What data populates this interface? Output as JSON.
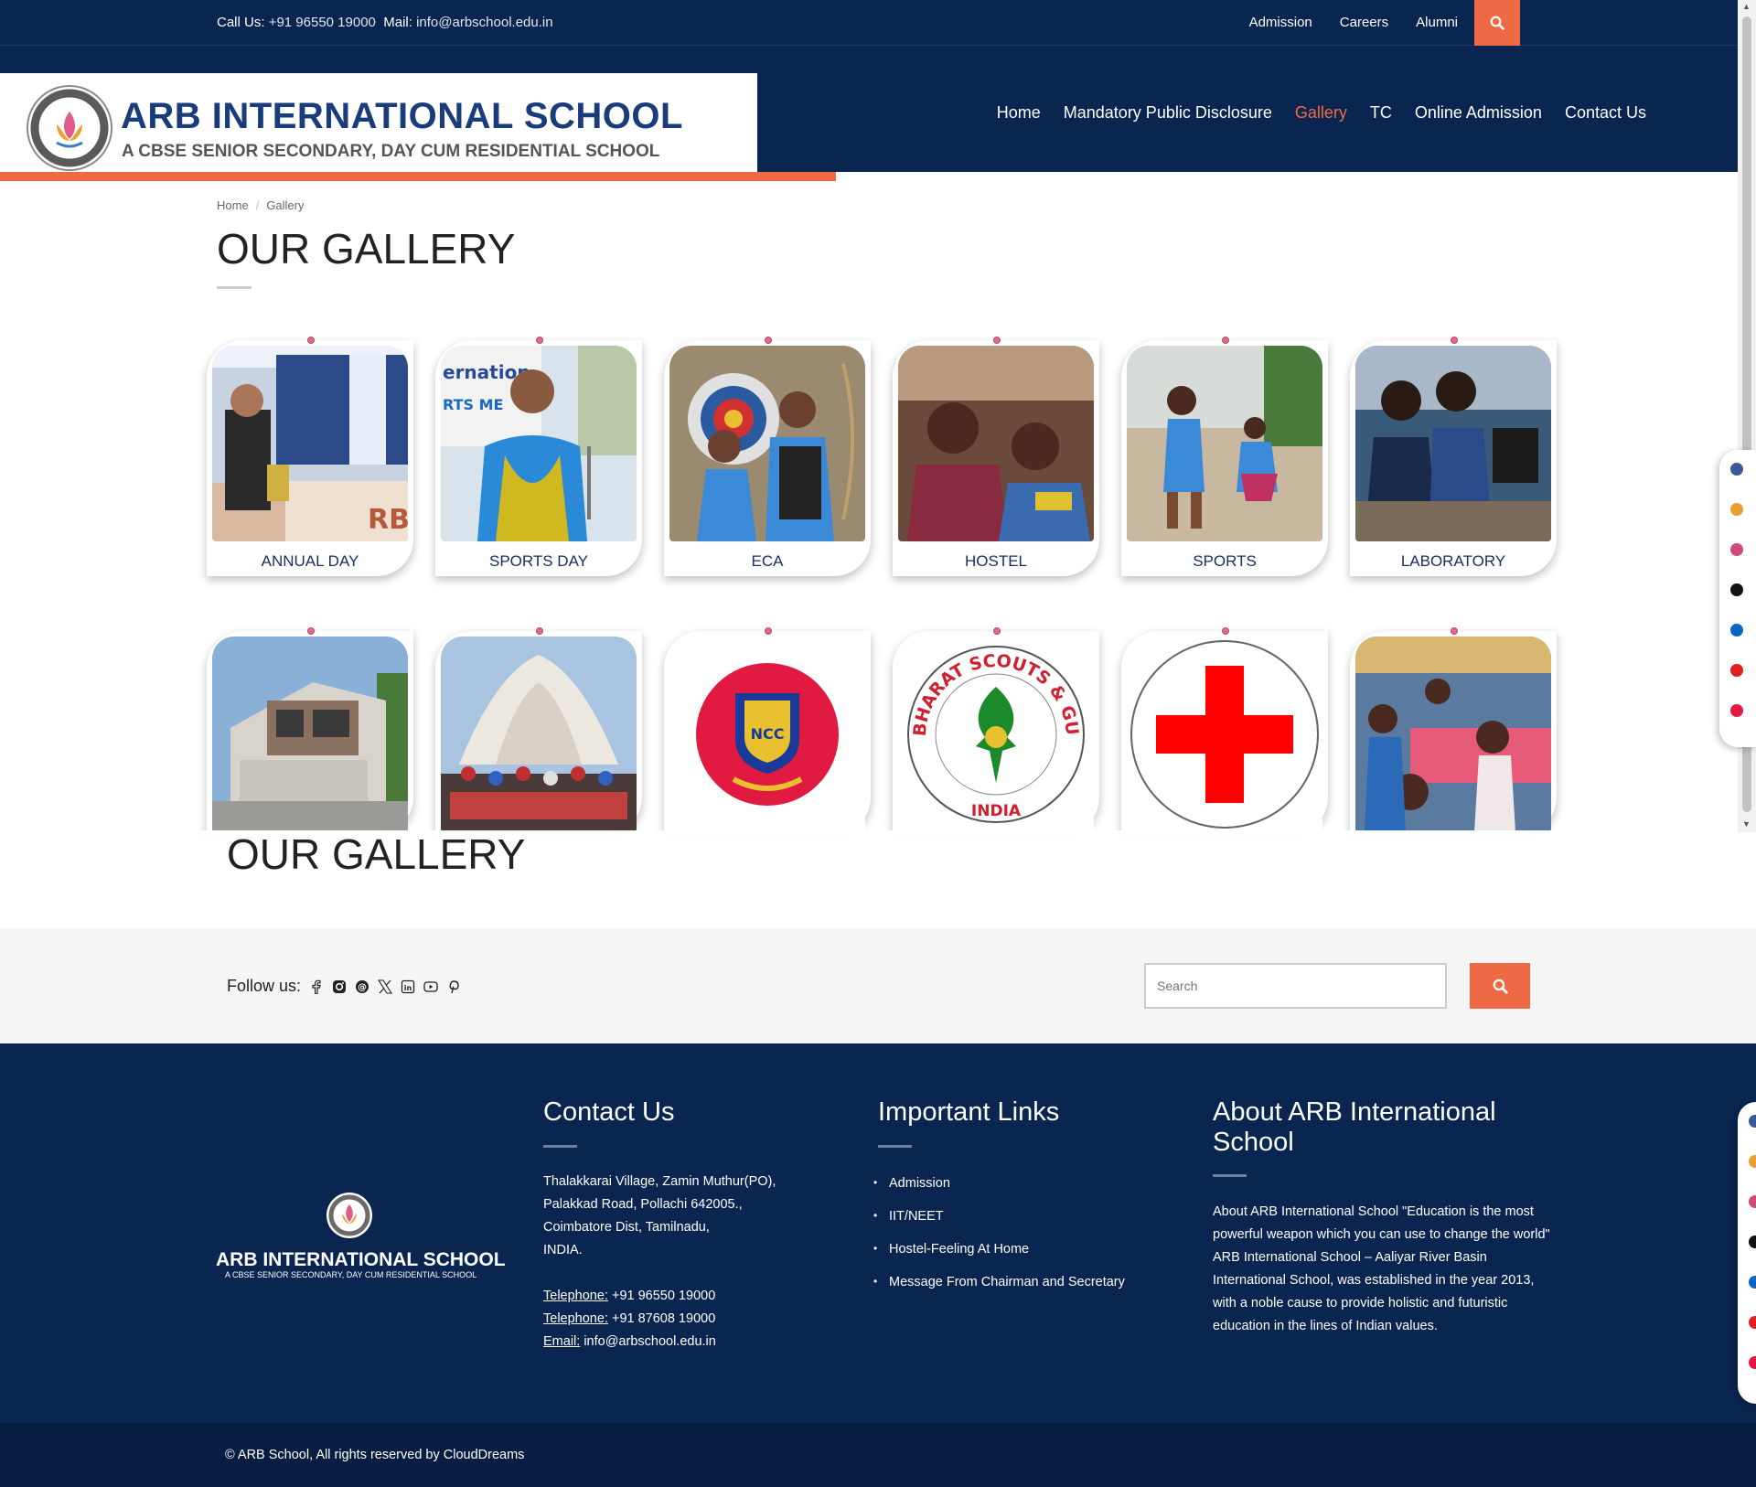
{
  "topbar": {
    "call_label": "Call Us:",
    "phone": "+91 96550 19000",
    "mail_label": "Mail:",
    "email": "info@arbschool.edu.in",
    "links": [
      "Admission",
      "Careers",
      "Alumni"
    ]
  },
  "header": {
    "school_name": "ARB INTERNATIONAL SCHOOL",
    "school_subtitle": "A CBSE SENIOR SECONDARY, DAY CUM RESIDENTIAL SCHOOL",
    "nav": {
      "home": "Home",
      "disclosure": "Mandatory Public Disclosure",
      "gallery": "Gallery",
      "tc": "TC",
      "online_admission": "Online Admission",
      "contact": "Contact Us"
    },
    "active_nav": "Gallery"
  },
  "breadcrumb": {
    "home": "Home",
    "current": "Gallery"
  },
  "page_title": "OUR GALLERY",
  "gallery": {
    "row1": [
      {
        "label": "ANNUAL DAY",
        "icon": "annual-day-photo"
      },
      {
        "label": "SPORTS DAY",
        "icon": "sports-day-photo"
      },
      {
        "label": "ECA",
        "icon": "eca-archery-photo"
      },
      {
        "label": "HOSTEL",
        "icon": "hostel-photo"
      },
      {
        "label": "SPORTS",
        "icon": "sports-photo"
      },
      {
        "label": "LABORATORY",
        "icon": "laboratory-photo"
      }
    ],
    "row2": [
      {
        "icon": "building-photo"
      },
      {
        "icon": "lotus-temple-group-photo"
      },
      {
        "icon": "ncc-logo",
        "logo_text": "NCC"
      },
      {
        "icon": "bharat-scouts-guides-logo",
        "logo_text_top": "THE BHARAT SCOUTS & GUIDES",
        "logo_text_bottom": "INDIA"
      },
      {
        "icon": "red-cross-logo"
      },
      {
        "icon": "classroom-photo"
      }
    ]
  },
  "repeat_title": "OUR GALLERY",
  "follow": {
    "label": "Follow us:",
    "icons": [
      "facebook-icon",
      "instagram-icon",
      "threads-icon",
      "x-icon",
      "linkedin-icon",
      "youtube-icon",
      "pinterest-icon"
    ]
  },
  "search": {
    "placeholder": "Search"
  },
  "footer": {
    "logo_name": "ARB INTERNATIONAL SCHOOL",
    "logo_sub": "A CBSE SENIOR SECONDARY, DAY CUM RESIDENTIAL SCHOOL",
    "contact": {
      "heading": "Contact Us",
      "address": [
        "Thalakkarai Village, Zamin Muthur(PO),",
        "Palakkad Road, Pollachi 642005.,",
        "Coimbatore Dist, Tamilnadu,",
        "INDIA."
      ],
      "tel_label": "Telephone:",
      "tel1": "+91 96550 19000",
      "tel2": "+91 87608 19000",
      "email_label": "Email:",
      "email": "info@arbschool.edu.in"
    },
    "links": {
      "heading": "Important Links",
      "items": [
        "Admission",
        "IIT/NEET",
        "Hostel-Feeling At Home",
        "Message From Chairman and Secretary"
      ]
    },
    "about": {
      "heading_line1": "About ARB International",
      "heading_line2": "School",
      "text": "About ARB International School \"Education is the most powerful weapon which you can use to change the world\" ARB International School – Aaliyar River Basin International School, was established in the year 2013, with a noble cause to provide holistic and futuristic education in the lines of Indian values."
    },
    "copyright": "© ARB School, All rights reserved by CloudDreams"
  },
  "colors": {
    "navy": "#0a2550",
    "accent": "#ef6a44",
    "footer_bottom": "#071d42"
  }
}
